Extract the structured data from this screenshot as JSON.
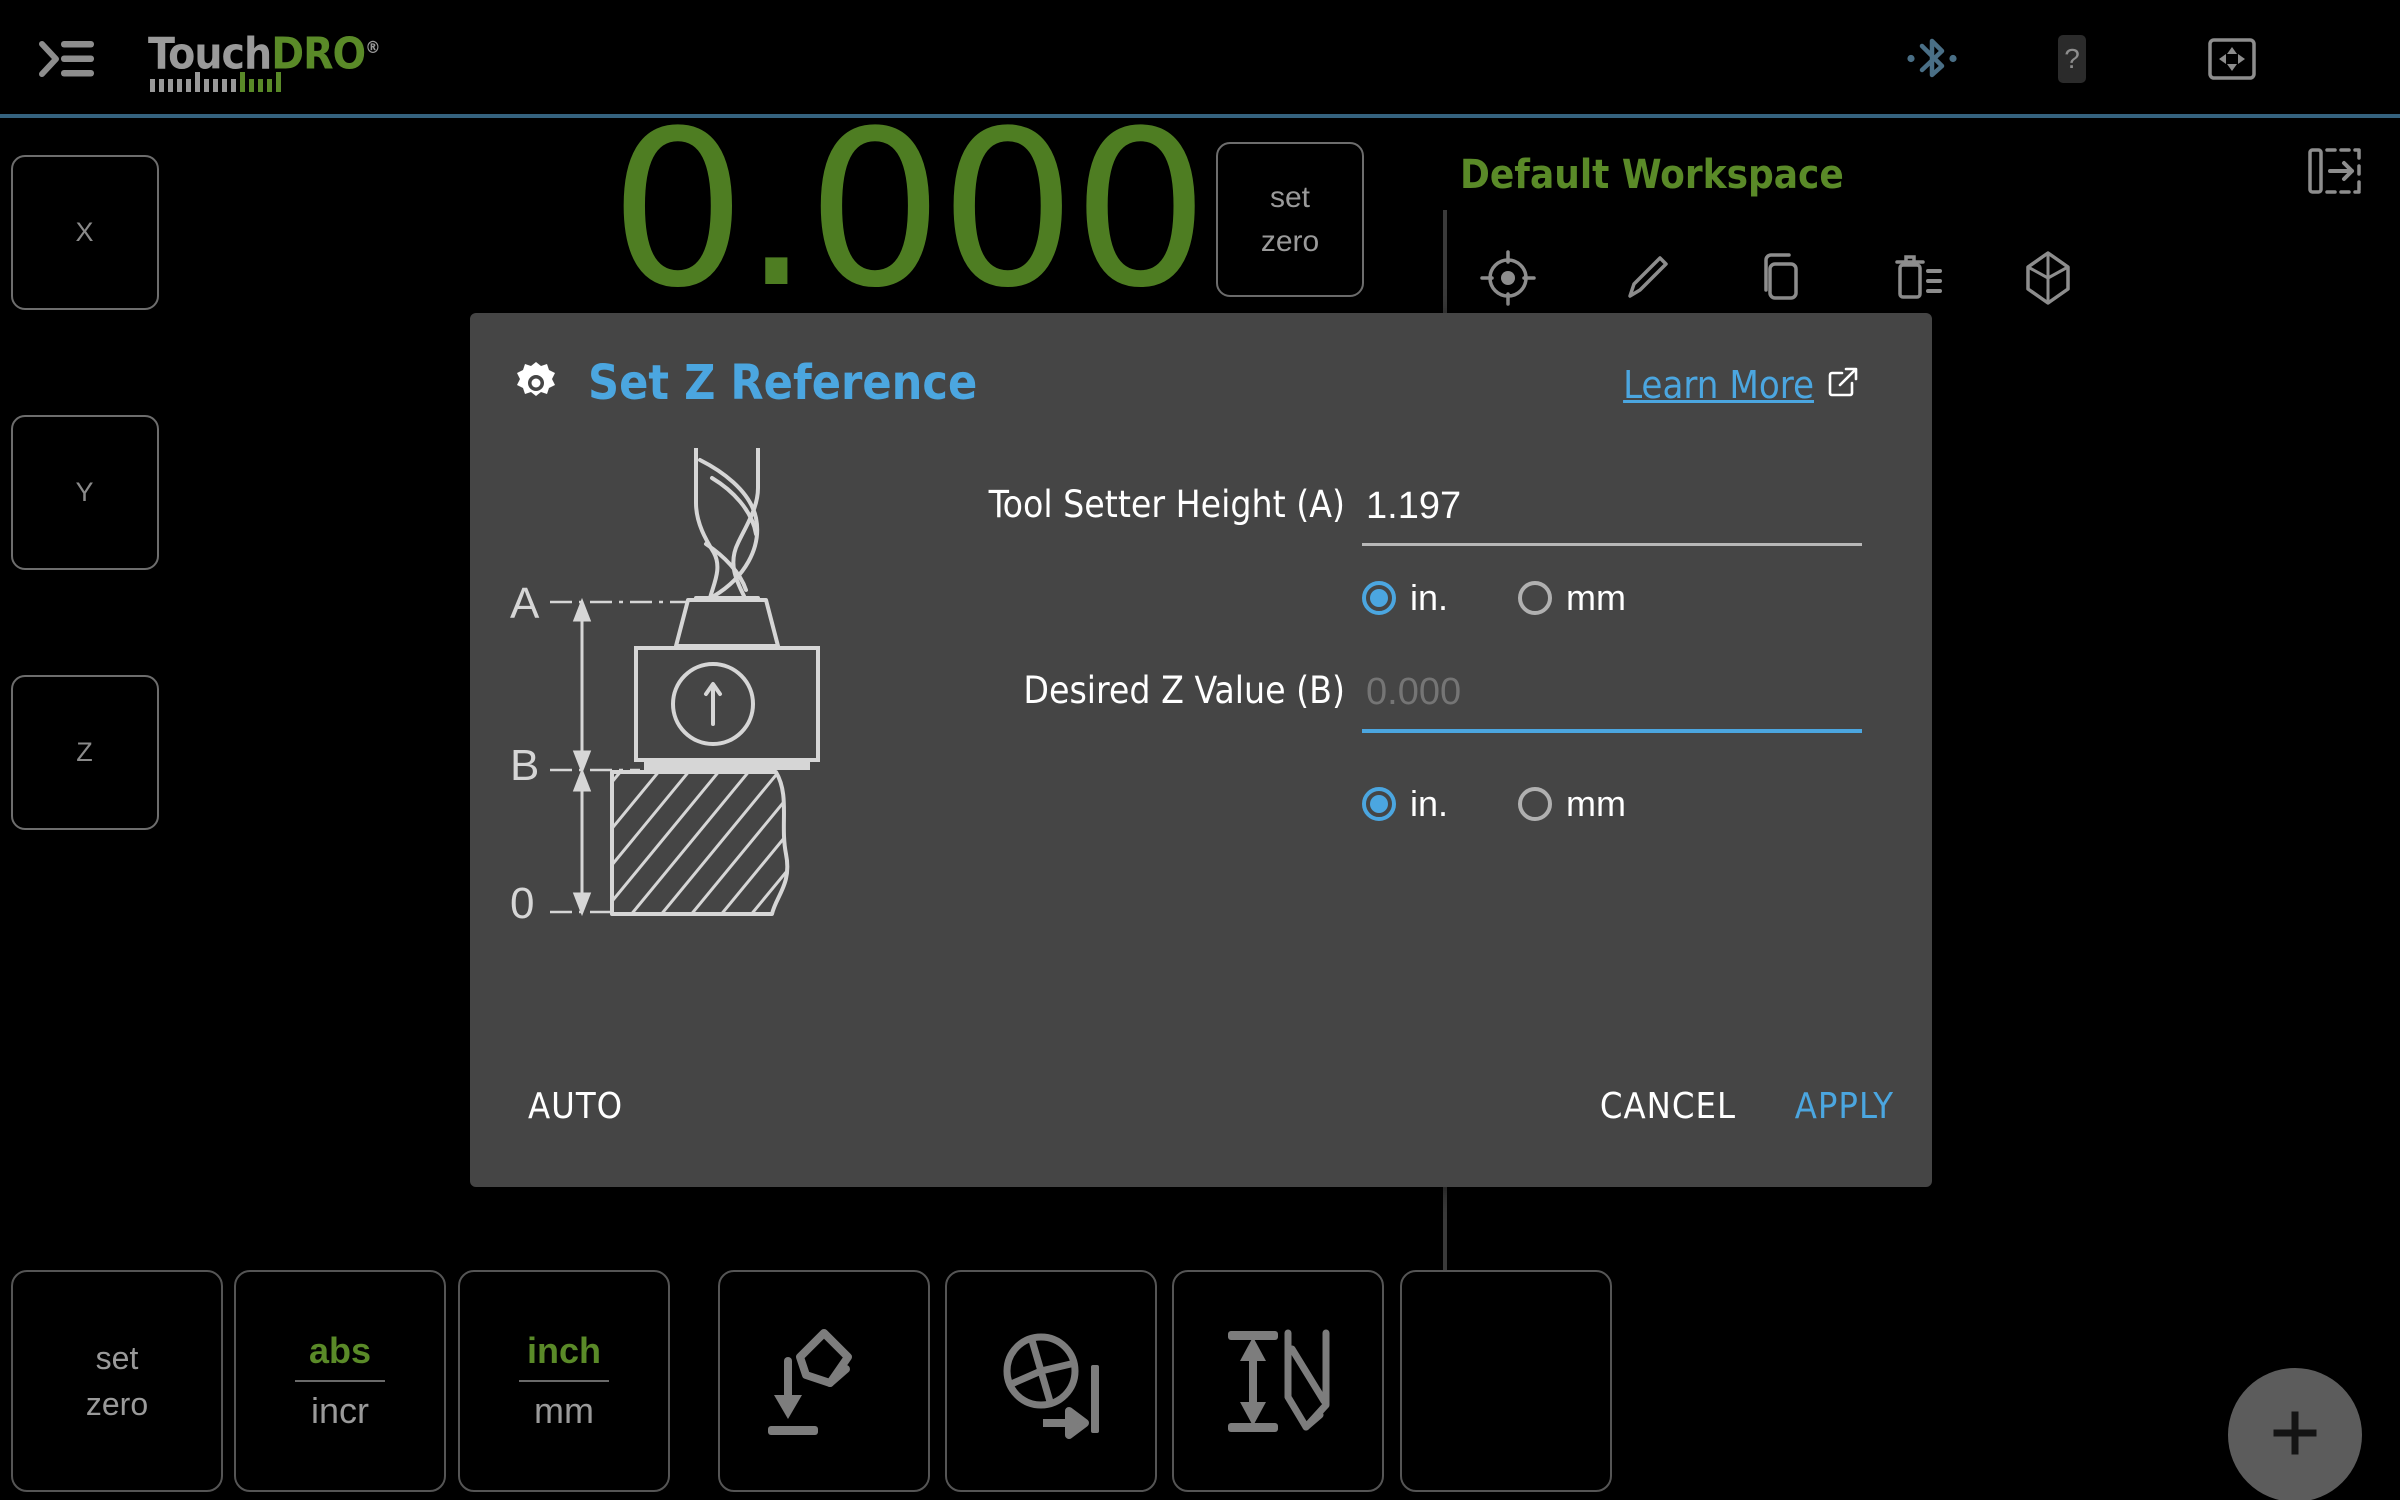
{
  "app": {
    "logo_primary": "Touch",
    "logo_accent": "DRO",
    "logo_reg": "®",
    "colors": {
      "accent_blue": "#4ba6e0",
      "accent_green": "#5a8a28",
      "dro_green": "#4e7d22",
      "divider_blue": "#35627e",
      "dialog_bg": "#454545",
      "background": "#000000"
    }
  },
  "topbar": {
    "menu_icon": "hamburger-menu-icon",
    "icons": [
      {
        "name": "bluetooth-icon",
        "label": "Bluetooth"
      },
      {
        "name": "device-help-icon",
        "label": "Device Help"
      },
      {
        "name": "fullscreen-icon",
        "label": "Fullscreen"
      }
    ]
  },
  "dro": {
    "axes": [
      {
        "label": "X"
      },
      {
        "label": "Y"
      },
      {
        "label": "Z"
      }
    ],
    "value": "0.000",
    "set_zero_line1": "set",
    "set_zero_line2": "zero"
  },
  "workspace": {
    "title": "Default Workspace",
    "icons": [
      {
        "name": "datum-target-icon"
      },
      {
        "name": "edit-pencil-icon"
      },
      {
        "name": "copy-icon"
      },
      {
        "name": "delete-list-icon"
      },
      {
        "name": "cube-3d-icon"
      }
    ],
    "panel_toggle_icon": "panel-expand-icon"
  },
  "toolbar": {
    "buttons": [
      {
        "name": "set-zero-button",
        "type": "text2",
        "line1": "set",
        "line2": "zero"
      },
      {
        "name": "abs-incr-toggle",
        "type": "toggle",
        "top": "abs",
        "bottom": "incr",
        "active": "abs"
      },
      {
        "name": "inch-mm-toggle",
        "type": "toggle",
        "top": "inch",
        "bottom": "mm",
        "active": "inch"
      },
      {
        "name": "tool-touch-off-button",
        "type": "icon",
        "icon": "tool-touch-down-icon"
      },
      {
        "name": "edge-finder-button",
        "type": "icon",
        "icon": "edge-find-icon"
      },
      {
        "name": "tool-height-button",
        "type": "icon",
        "icon": "tool-height-icon"
      },
      {
        "name": "more-tools-button",
        "type": "icon",
        "icon": "partial-button-icon"
      }
    ],
    "fab": {
      "name": "add-button",
      "icon": "plus-icon"
    }
  },
  "dialog": {
    "gear_icon": "gear-icon",
    "title": "Set Z Reference",
    "learn_more": "Learn More",
    "external_link_icon": "external-link-icon",
    "diagram": {
      "labels": {
        "a": "A",
        "b": "B",
        "zero": "0"
      },
      "description": "end-mill-on-tool-setter-diagram"
    },
    "fields": [
      {
        "name": "tool-setter-height-field",
        "label": "Tool Setter Height (A)",
        "value": "1.197",
        "placeholder": "",
        "is_placeholder": false,
        "focused": false,
        "units": {
          "option1": "in.",
          "option2": "mm",
          "selected": "in."
        }
      },
      {
        "name": "desired-z-value-field",
        "label": "Desired Z Value (B)",
        "value": "",
        "placeholder": "0.000",
        "is_placeholder": true,
        "focused": true,
        "units": {
          "option1": "in.",
          "option2": "mm",
          "selected": "in."
        }
      }
    ],
    "auto_label": "AUTO",
    "cancel_label": "CANCEL",
    "apply_label": "APPLY"
  }
}
